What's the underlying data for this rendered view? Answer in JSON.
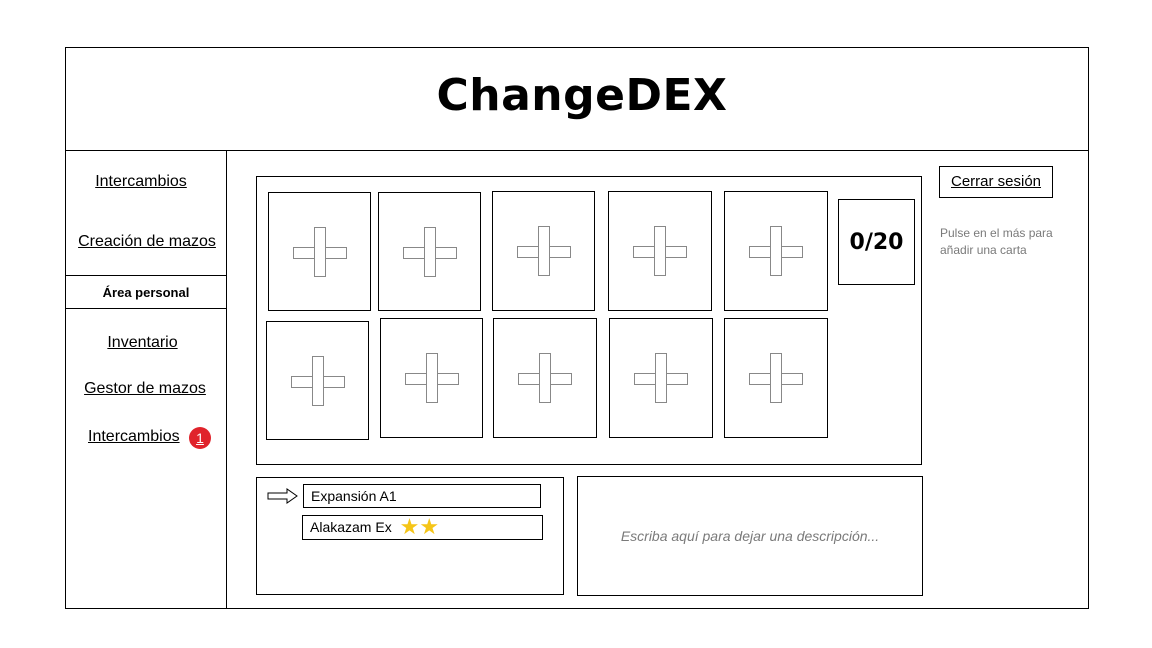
{
  "header": {
    "title": "ChangeDEX"
  },
  "sidebar": {
    "top_links": [
      {
        "label": "Intercambios"
      },
      {
        "label": "Creación de mazos"
      }
    ],
    "section_label": "Área personal",
    "personal_links": [
      {
        "label": "Inventario"
      },
      {
        "label": "Gestor de mazos"
      },
      {
        "label": "Intercambios",
        "badge": "1"
      }
    ]
  },
  "deck": {
    "slots": [
      {
        "icon": "plus-icon"
      },
      {
        "icon": "plus-icon"
      },
      {
        "icon": "plus-icon"
      },
      {
        "icon": "plus-icon"
      },
      {
        "icon": "plus-icon"
      },
      {
        "icon": "plus-icon"
      },
      {
        "icon": "plus-icon"
      },
      {
        "icon": "plus-icon"
      },
      {
        "icon": "plus-icon"
      },
      {
        "icon": "plus-icon"
      }
    ],
    "counter": "0/20"
  },
  "right_panel": {
    "logout_label": "Cerrar sesión",
    "hint": "Pulse en el más para añadir una carta"
  },
  "selector": {
    "expansion": "Expansión A1",
    "card": "Alakazam Ex",
    "card_rarity_stars": 2,
    "arrow_icon": "arrow-right-icon"
  },
  "description": {
    "placeholder": "Escriba aquí para dejar una descripción..."
  },
  "colors": {
    "badge": "#e0232b",
    "star": "#f5c518",
    "hint_text": "#7a7a7a"
  }
}
